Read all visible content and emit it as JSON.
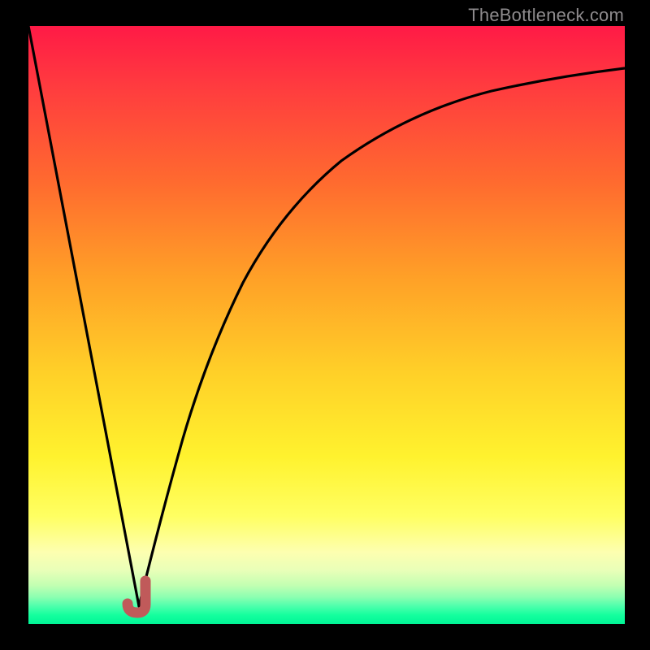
{
  "watermark": "TheBottleneck.com",
  "colors": {
    "frame": "#000000",
    "curve": "#000000",
    "marker": "#c05a5a",
    "gradient_top": "#ff1a46",
    "gradient_bottom": "#00f596"
  },
  "chart_data": {
    "type": "line",
    "title": "",
    "xlabel": "",
    "ylabel": "",
    "xlim": [
      0,
      100
    ],
    "ylim": [
      0,
      100
    ],
    "grid": false,
    "series": [
      {
        "name": "left-descent",
        "x": [
          0,
          18.5
        ],
        "y": [
          100,
          3
        ],
        "note": "straight segment from top-left down to valley"
      },
      {
        "name": "right-ascent",
        "x": [
          18.5,
          22,
          26,
          31,
          36,
          42,
          50,
          60,
          72,
          86,
          100
        ],
        "y": [
          3,
          16,
          31,
          45,
          57,
          67,
          76,
          83,
          88,
          91.5,
          93
        ],
        "note": "concave-down rise approaching ~93 at right edge"
      }
    ],
    "marker": {
      "name": "valley-marker",
      "shape": "J-hook",
      "x": 18,
      "y": 3,
      "approx_extent_x": [
        16.5,
        20
      ],
      "approx_extent_y": [
        2,
        7
      ]
    },
    "annotations": []
  }
}
